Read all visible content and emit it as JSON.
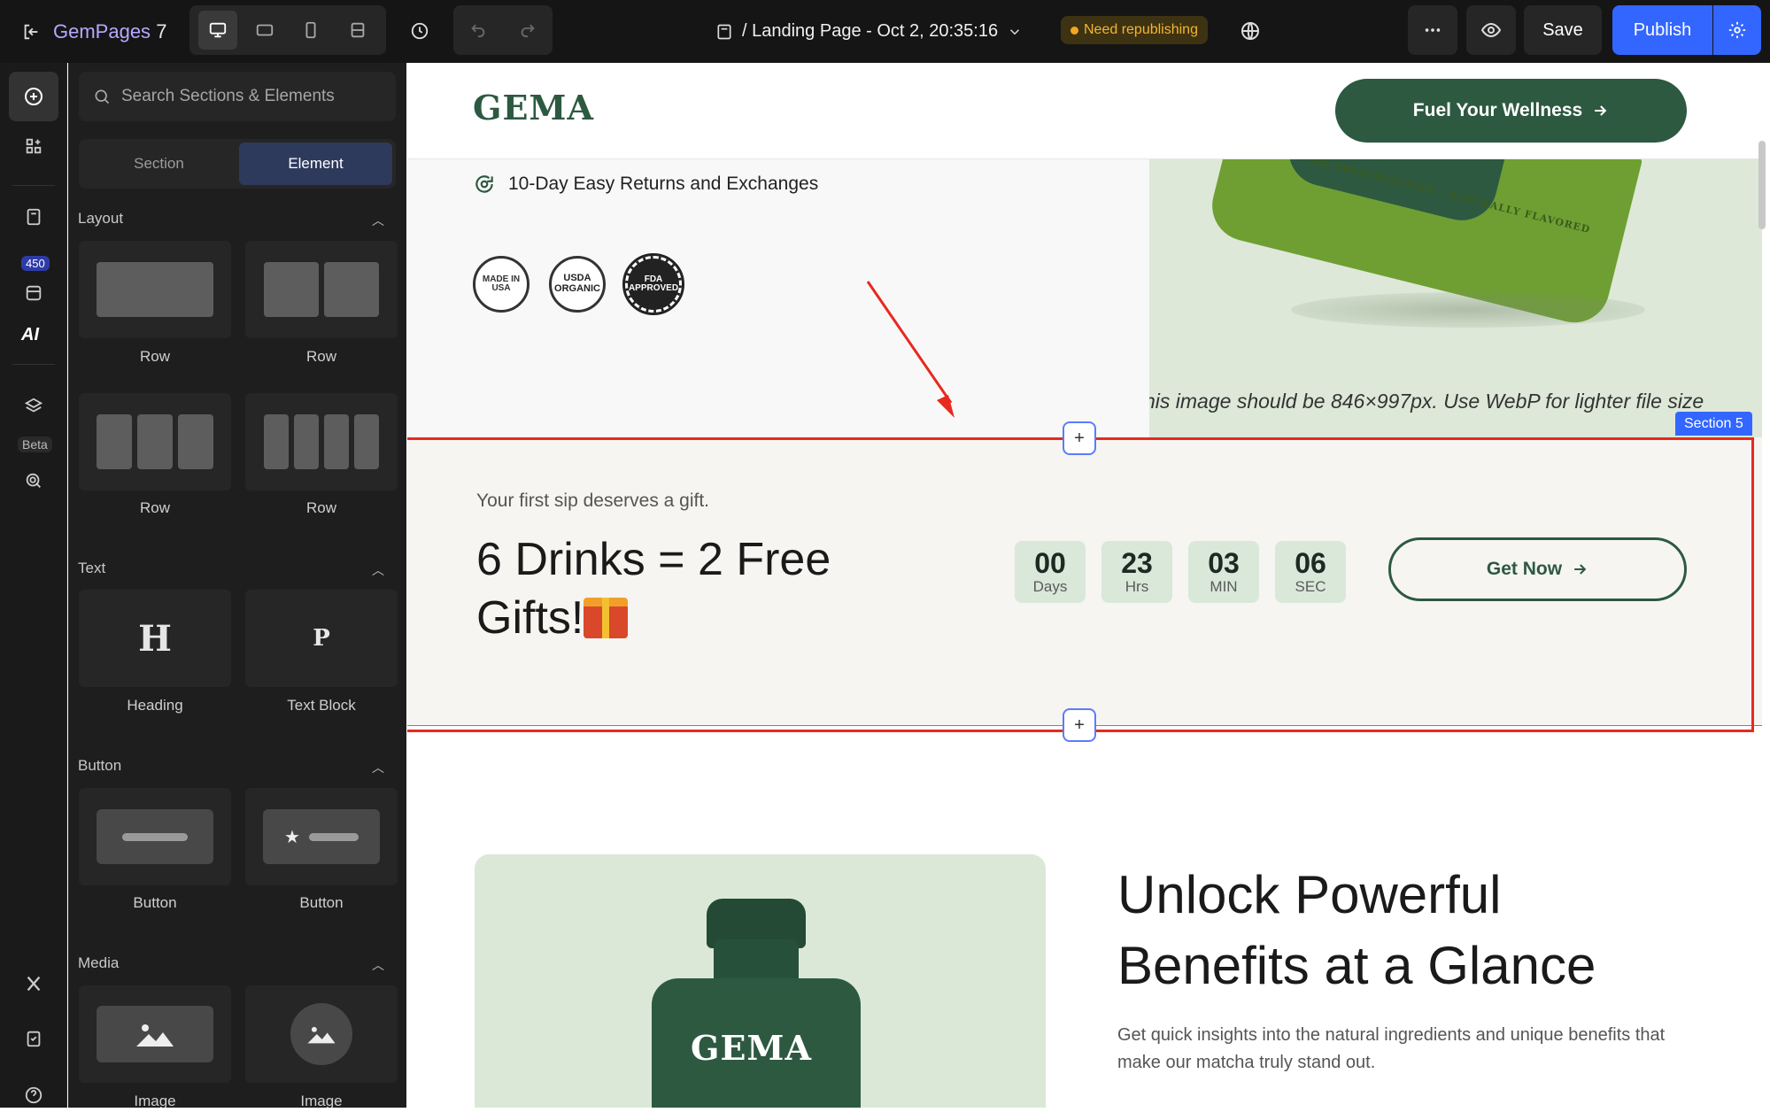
{
  "topbar": {
    "brand": "GemPages",
    "brand_version": "7",
    "page_title": "/ Landing Page - Oct 2, 20:35:16",
    "status_badge": "Need republishing",
    "save_label": "Save",
    "publish_label": "Publish"
  },
  "rail": {
    "library_count": "450",
    "beta_label": "Beta"
  },
  "panel": {
    "search_placeholder": "Search Sections & Elements",
    "tabs": [
      "Section",
      "Element"
    ],
    "active_tab": "Element",
    "categories": {
      "layout": {
        "title": "Layout",
        "items": [
          "Row",
          "Row",
          "Row",
          "Row"
        ]
      },
      "text": {
        "title": "Text",
        "items": [
          "Heading",
          "Text Block"
        ]
      },
      "button": {
        "title": "Button",
        "items": [
          "Button",
          "Button"
        ]
      },
      "media": {
        "title": "Media",
        "items": [
          "Image",
          "Image"
        ]
      }
    }
  },
  "canvas": {
    "logo": "GEMA",
    "header_cta": "Fuel Your Wellness",
    "returns_text": "10-Day Easy Returns and Exchanges",
    "cert_badges": [
      "MADE IN USA",
      "USDA ORGANIC",
      "FDA APPROVED"
    ],
    "pouch_text": "NO PRESERVATIVES · NATURALLY FLAVORED",
    "image_note": "his image should be 846×997px. Use WebP for lighter file size",
    "section_tag": "Section 5",
    "promo": {
      "subtitle": "Your first sip deserves a gift.",
      "title": "6 Drinks = 2 Free Gifts!",
      "timer": [
        {
          "value": "00",
          "unit": "Days"
        },
        {
          "value": "23",
          "unit": "Hrs"
        },
        {
          "value": "03",
          "unit": "MIN"
        },
        {
          "value": "06",
          "unit": "SEC"
        }
      ],
      "cta": "Get Now"
    },
    "benefits": {
      "bottle_logo": "GEMA",
      "title": "Unlock Powerful Benefits at a Glance",
      "text": "Get quick insights into the natural ingredients and unique benefits that make our matcha truly stand out."
    }
  },
  "colors": {
    "brand_green": "#2d5941",
    "publish_blue": "#3366ff",
    "selection_red": "#e8291f",
    "badge_amber": "#f5a623"
  }
}
